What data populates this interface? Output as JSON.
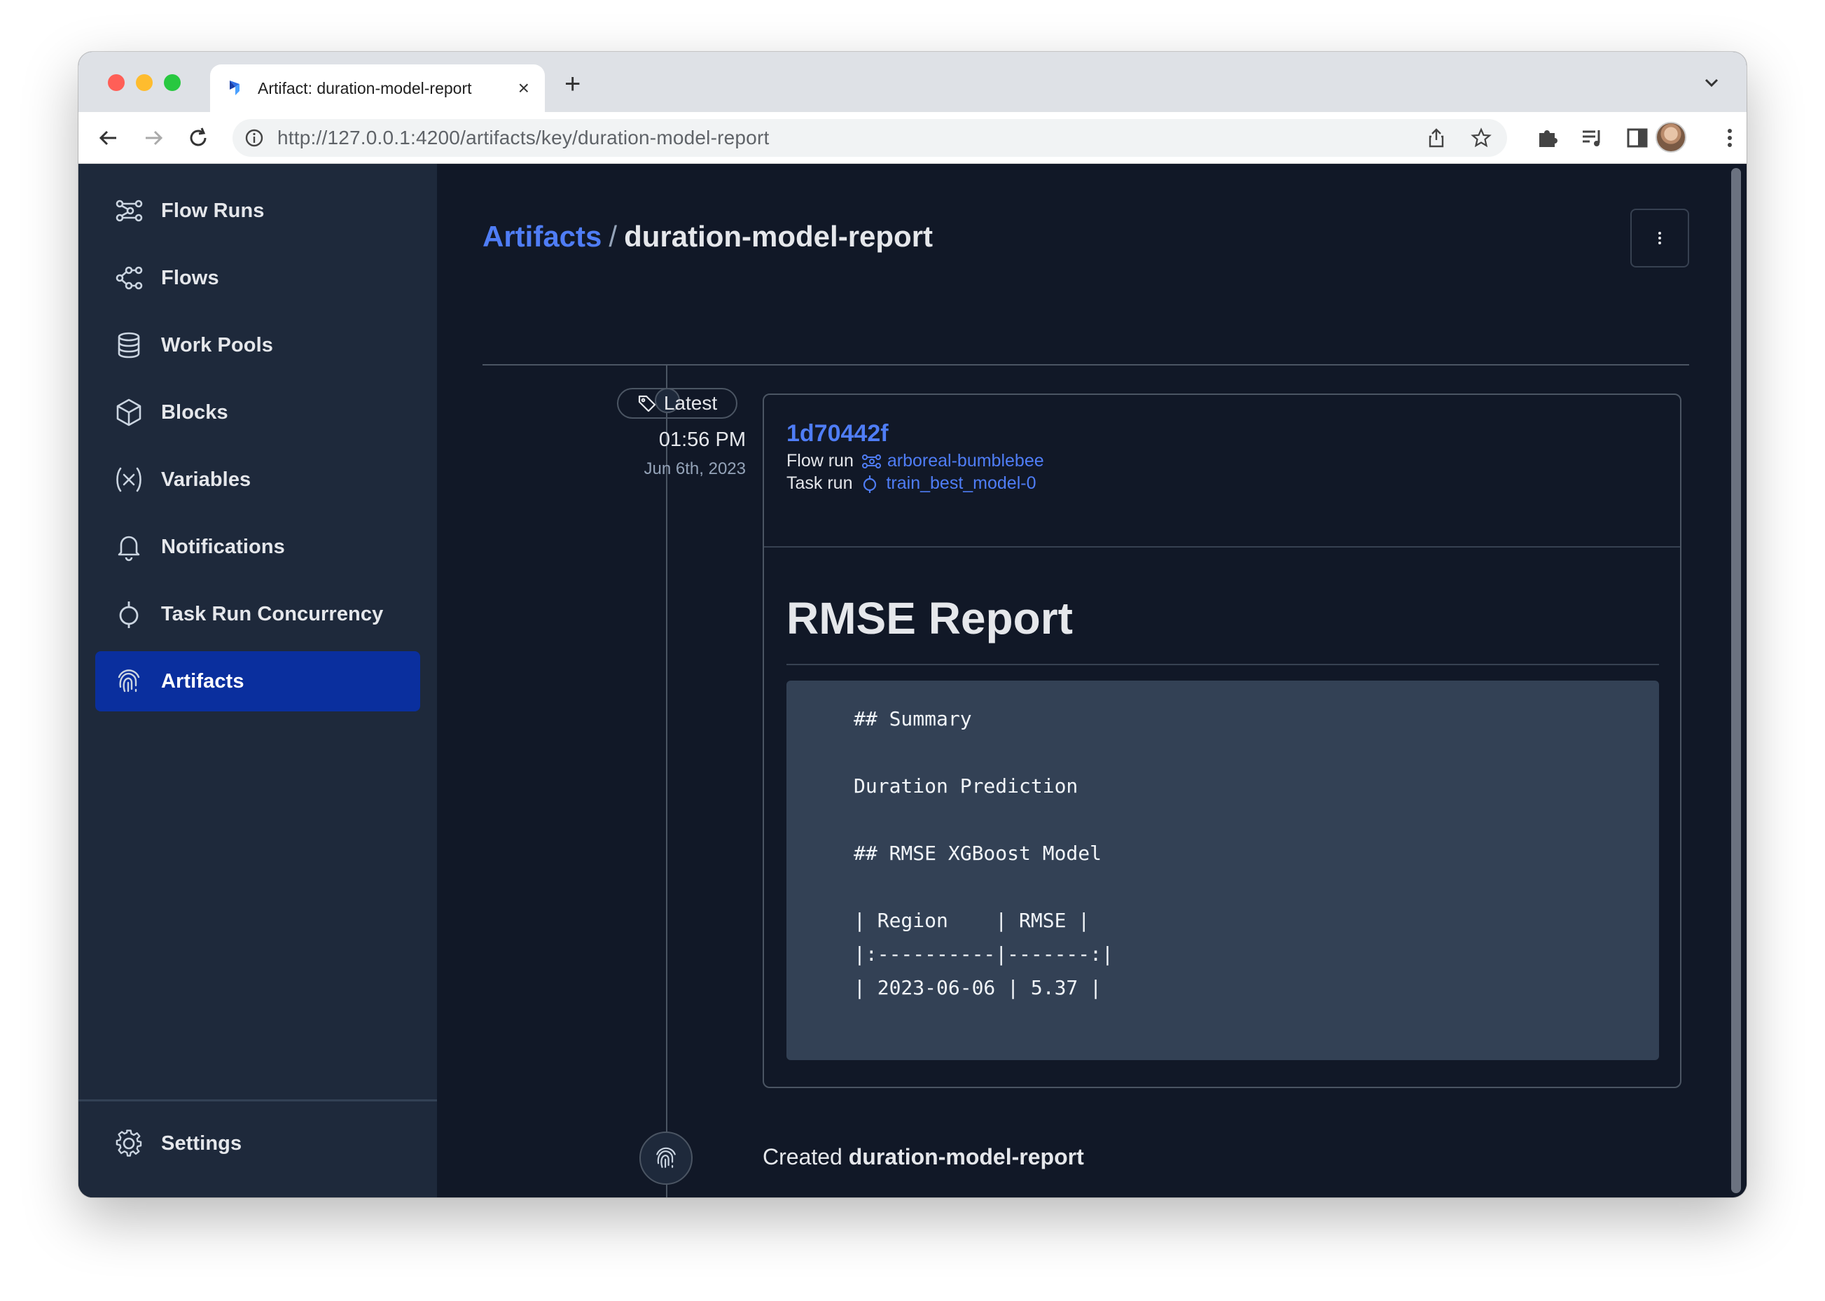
{
  "browser": {
    "tab_title": "Artifact: duration-model-report",
    "url_host": "http://127.0.0.1",
    "url_rest": ":4200/artifacts/key/duration-model-report"
  },
  "sidebar": {
    "items": [
      {
        "label": "Flow Runs",
        "icon": "flow-runs-icon"
      },
      {
        "label": "Flows",
        "icon": "flows-icon"
      },
      {
        "label": "Work Pools",
        "icon": "database-icon"
      },
      {
        "label": "Blocks",
        "icon": "cube-icon"
      },
      {
        "label": "Variables",
        "icon": "variable-icon"
      },
      {
        "label": "Notifications",
        "icon": "bell-icon"
      },
      {
        "label": "Task Run Concurrency",
        "icon": "task-run-icon"
      },
      {
        "label": "Artifacts",
        "icon": "fingerprint-icon",
        "active": true
      }
    ],
    "settings_label": "Settings"
  },
  "page": {
    "breadcrumb_root": "Artifacts",
    "breadcrumb_sep": "/",
    "breadcrumb_current": "duration-model-report"
  },
  "timeline": {
    "tag_label": "Latest",
    "time": "01:56 PM",
    "date": "Jun 6th, 2023",
    "card": {
      "id": "1d70442f",
      "flow_run_label": "Flow run",
      "flow_run_value": "arboreal-bumblebee",
      "task_run_label": "Task run",
      "task_run_value": "train_best_model-0",
      "report_title": "RMSE Report",
      "code_lines": [
        "## Summary",
        "Duration Prediction",
        "## RMSE XGBoost Model",
        "| Region    | RMSE |",
        "|:----------|-------:|",
        "| 2023-06-06 | 5.37 |"
      ]
    },
    "created_prefix": "Created",
    "created_name": "duration-model-report"
  },
  "colors": {
    "accent": "#4f7df6",
    "active_nav": "#0a2f9e",
    "sidebar_bg": "#1e293b",
    "main_bg": "#111827",
    "code_bg": "#334155"
  }
}
